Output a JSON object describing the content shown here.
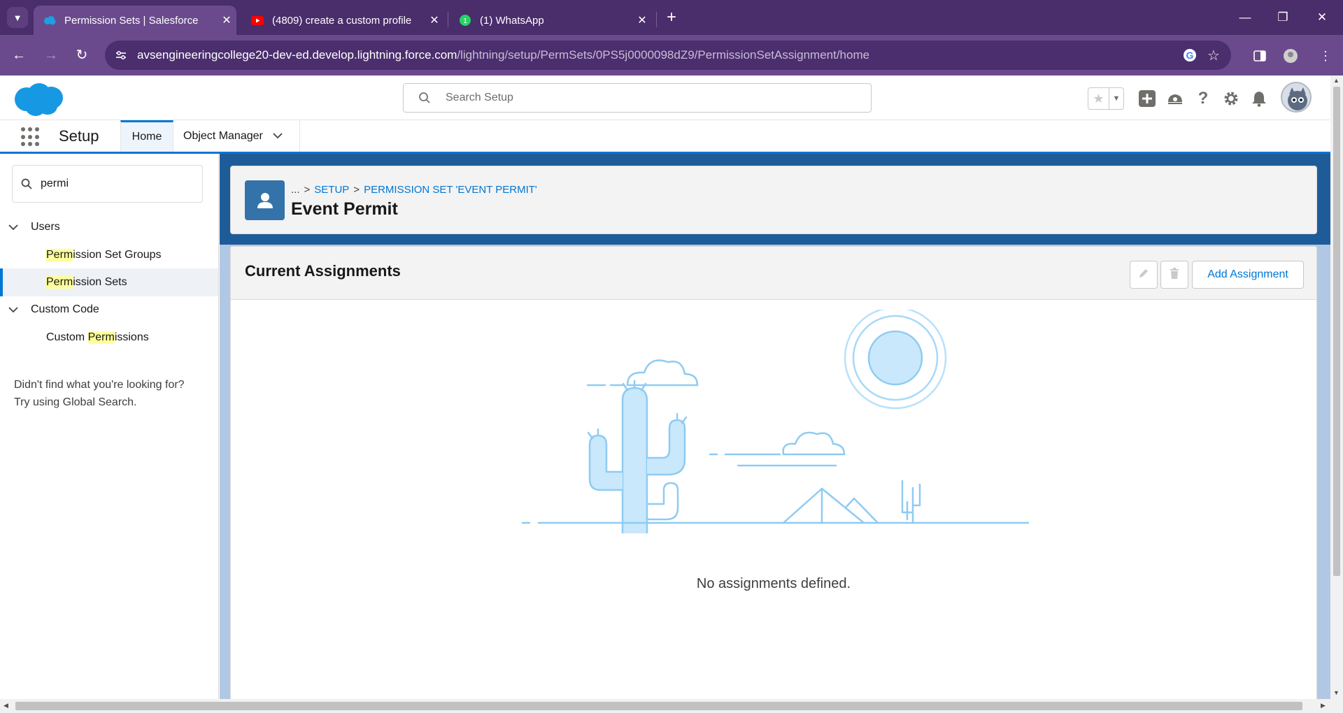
{
  "browser": {
    "tabs": [
      {
        "title": "Permission Sets | Salesforce",
        "icon": "salesforce-cloud-icon"
      },
      {
        "title": "(4809) create a custom profile",
        "icon": "youtube-icon"
      },
      {
        "title": "(1) WhatsApp",
        "icon": "whatsapp-icon"
      }
    ],
    "url_host": "avsengineeringcollege20-dev-ed.develop.lightning.force.com",
    "url_path": "/lightning/setup/PermSets/0PS5j0000098dZ9/PermissionSetAssignment/home"
  },
  "header": {
    "search_placeholder": "Search Setup"
  },
  "nav": {
    "app_name": "Setup",
    "tabs": [
      {
        "label": "Home"
      },
      {
        "label": "Object Manager"
      }
    ]
  },
  "sidebar": {
    "quickfind_value": "permi",
    "sections": [
      {
        "label": "Users"
      },
      {
        "label": "Custom Code"
      }
    ],
    "items": [
      {
        "match": "Perm",
        "label": "ission Set Groups"
      },
      {
        "match": "Perm",
        "label": "ission Sets"
      },
      {
        "prefix": "Custom ",
        "match": "Perm",
        "label": "issions"
      }
    ],
    "no_find_line1": "Didn't find what you're looking for?",
    "no_find_line2": "Try using Global Search."
  },
  "page": {
    "breadcrumb_dots": "...",
    "breadcrumb_setup": "Setup",
    "breadcrumb_permset": "Permission Set 'Event Permit'",
    "title": "Event Permit"
  },
  "card": {
    "title": "Current Assignments",
    "add_button": "Add Assignment",
    "empty_message": "No assignments defined."
  },
  "colors": {
    "chrome_tabbar": "#4a2d6b",
    "chrome_toolbar": "#6a4a8c",
    "sf_brand": "#0176d3",
    "content_band": "#1e5c99",
    "highlight": "#ffff9a"
  }
}
